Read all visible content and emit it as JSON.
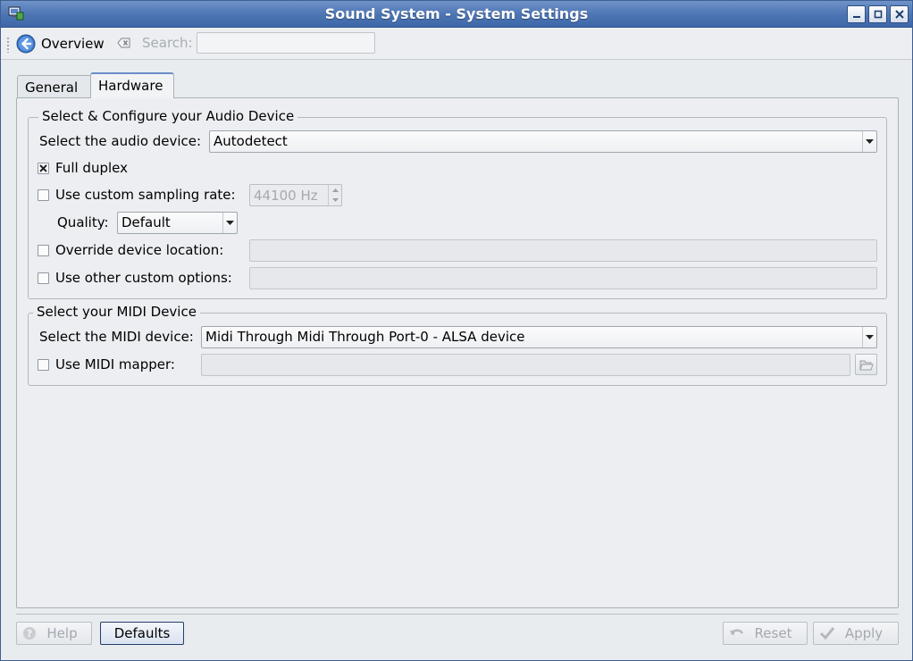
{
  "window": {
    "title": "Sound System - System Settings"
  },
  "toolbar": {
    "overview_label": "Overview",
    "search_label": "Search:",
    "search_value": ""
  },
  "tabs": [
    {
      "label": "General",
      "active": false
    },
    {
      "label": "Hardware",
      "active": true
    }
  ],
  "audio_group": {
    "title": "Select & Configure your Audio Device",
    "device_label": "Select the audio device:",
    "device_value": "Autodetect",
    "full_duplex_label": "Full duplex",
    "full_duplex_checked": true,
    "custom_rate_label": "Use custom sampling rate:",
    "custom_rate_checked": false,
    "custom_rate_value": "44100 Hz",
    "quality_label": "Quality:",
    "quality_value": "Default",
    "override_location_label": "Override device location:",
    "override_location_checked": false,
    "override_location_value": "",
    "custom_options_label": "Use other custom options:",
    "custom_options_checked": false,
    "custom_options_value": ""
  },
  "midi_group": {
    "title": "Select your MIDI Device",
    "device_label": "Select the MIDI device:",
    "device_value": "Midi Through  Midi Through Port-0 - ALSA device",
    "mapper_label": "Use MIDI mapper:",
    "mapper_checked": false,
    "mapper_value": ""
  },
  "buttons": {
    "help": "Help",
    "defaults": "Defaults",
    "reset": "Reset",
    "apply": "Apply"
  },
  "colors": {
    "titlebar": "#4c74b3",
    "window_bg": "#eceef1",
    "accent": "#6a8ec7"
  },
  "icons": {
    "app": "monitor-speaker-icon",
    "overview": "back-arrow-icon",
    "search_clear": "clear-icon",
    "help": "help-icon",
    "reset": "undo-icon",
    "apply": "checkmark-icon",
    "file_open": "folder-open-icon"
  }
}
